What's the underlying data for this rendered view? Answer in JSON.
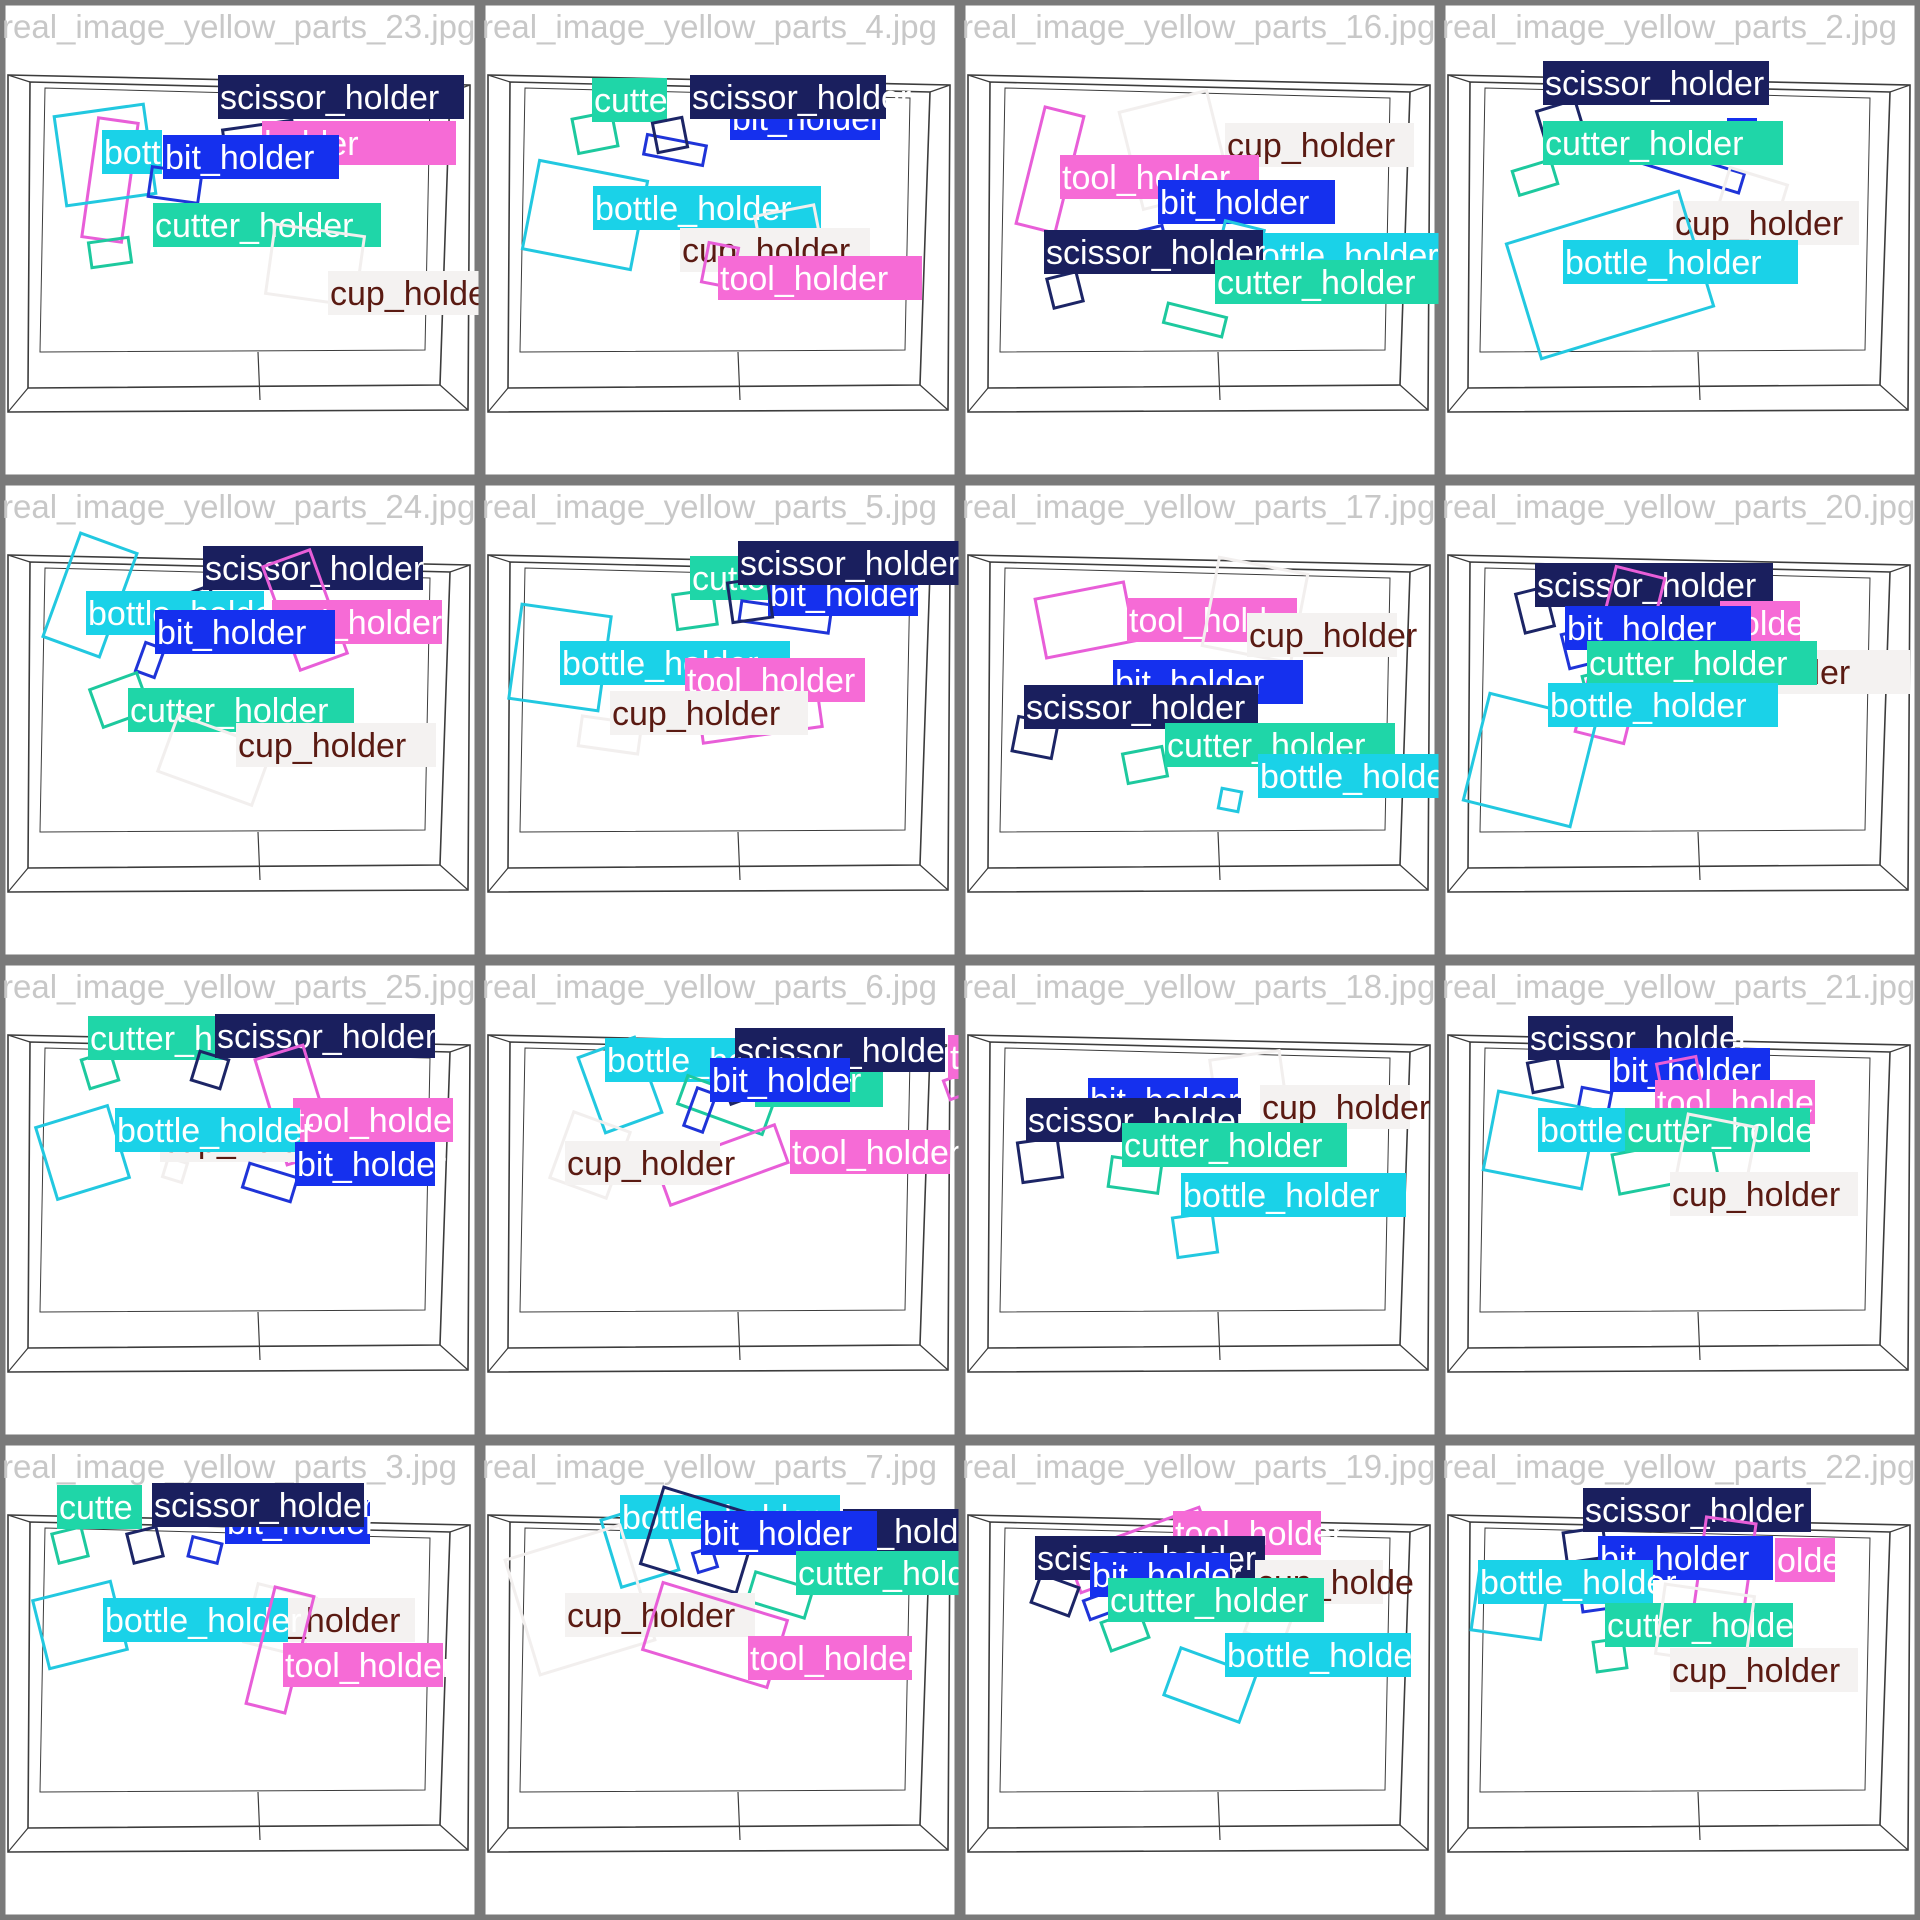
{
  "classes": {
    "scissor_holder": {
      "box": "#1c2566",
      "label_bg": "#1a1f5e",
      "label_fg": "#ffffff"
    },
    "bit_holder": {
      "box": "#1f34d8",
      "label_bg": "#1530ee",
      "label_fg": "#ffffff"
    },
    "tool_holder": {
      "box": "#e85ed8",
      "label_bg": "#f66bd6",
      "label_fg": "#ffffff"
    },
    "cutter_holder": {
      "box": "#1dc99e",
      "label_bg": "#1fd6a8",
      "label_fg": "#ffffff"
    },
    "bottle_holder": {
      "box": "#22c8e0",
      "label_bg": "#1ad2e8",
      "label_fg": "#ffffff"
    },
    "cup_holder": {
      "box": "#f2efee",
      "label_bg": "#f4f2f1",
      "label_fg": "#5a1a12"
    }
  },
  "tiles": [
    {
      "title": "real_image_yellow_parts_23.jpg",
      "labels": [
        {
          "cls": "scissor_holder",
          "text": "scissor_holder"
        },
        {
          "cls": "tool_holder",
          "text": "holder"
        },
        {
          "cls": "bottle_holder",
          "text": "bott"
        },
        {
          "cls": "bit_holder",
          "text": "bit_holder"
        },
        {
          "cls": "cutter_holder",
          "text": "cutter_holder"
        },
        {
          "cls": "cup_holder",
          "text": "cup_holder"
        }
      ]
    },
    {
      "title": "real_image_yellow_parts_4.jpg",
      "labels": [
        {
          "cls": "cutter_holder",
          "text": "cutter"
        },
        {
          "cls": "bit_holder",
          "text": "bit_holder"
        },
        {
          "cls": "scissor_holder",
          "text": "scissor_holder"
        },
        {
          "cls": "bottle_holder",
          "text": "bottle_holder"
        },
        {
          "cls": "cup_holder",
          "text": "cup_holder"
        },
        {
          "cls": "tool_holder",
          "text": "tool_holder"
        }
      ]
    },
    {
      "title": "real_image_yellow_parts_16.jpg",
      "labels": [
        {
          "cls": "cup_holder",
          "text": "cup_holder"
        },
        {
          "cls": "tool_holder",
          "text": "tool_holder"
        },
        {
          "cls": "bit_holder",
          "text": "bit_holder"
        },
        {
          "cls": "bottle_holder",
          "text": "bottle_holder"
        },
        {
          "cls": "scissor_holder",
          "text": "scissor_holder"
        },
        {
          "cls": "cutter_holder",
          "text": "cutter_holder"
        }
      ]
    },
    {
      "title": "real_image_yellow_parts_2.jpg",
      "labels": [
        {
          "cls": "scissor_holder",
          "text": "scissor_holder"
        },
        {
          "cls": "bit_holder",
          "text": "r"
        },
        {
          "cls": "cutter_holder",
          "text": "cutter_holder"
        },
        {
          "cls": "cup_holder",
          "text": "cup_holder"
        },
        {
          "cls": "bottle_holder",
          "text": "bottle_holder"
        }
      ]
    },
    {
      "title": "real_image_yellow_parts_24.jpg",
      "labels": [
        {
          "cls": "scissor_holder",
          "text": "scissor_holder"
        },
        {
          "cls": "bottle_holder",
          "text": "bottle_holder"
        },
        {
          "cls": "tool_holder",
          "text": "tool_holder"
        },
        {
          "cls": "bit_holder",
          "text": "bit_holder"
        },
        {
          "cls": "cutter_holder",
          "text": "cutter_holder"
        },
        {
          "cls": "cup_holder",
          "text": "cup_holder"
        }
      ]
    },
    {
      "title": "real_image_yellow_parts_5.jpg",
      "labels": [
        {
          "cls": "cutter_holder",
          "text": "cutter"
        },
        {
          "cls": "bit_holder",
          "text": "bit_holder"
        },
        {
          "cls": "scissor_holder",
          "text": "scissor_holder"
        },
        {
          "cls": "bottle_holder",
          "text": "bottle_holder"
        },
        {
          "cls": "tool_holder",
          "text": "tool_holder"
        },
        {
          "cls": "cup_holder",
          "text": "cup_holder"
        }
      ]
    },
    {
      "title": "real_image_yellow_parts_17.jpg",
      "labels": [
        {
          "cls": "tool_holder",
          "text": "tool_hold"
        },
        {
          "cls": "cup_holder",
          "text": "cup_holder"
        },
        {
          "cls": "bit_holder",
          "text": "bit_holder"
        },
        {
          "cls": "scissor_holder",
          "text": "scissor_holder"
        },
        {
          "cls": "cutter_holder",
          "text": "cutter_holder"
        },
        {
          "cls": "bottle_holder",
          "text": "bottle_holder"
        }
      ]
    },
    {
      "title": "real_image_yellow_parts_20.jpg",
      "labels": [
        {
          "cls": "scissor_holder",
          "text": "scissor_holder"
        },
        {
          "cls": "tool_holder",
          "text": "holder"
        },
        {
          "cls": "bit_holder",
          "text": "bit_holder"
        },
        {
          "cls": "cup_holder",
          "text": "cup_holder"
        },
        {
          "cls": "cutter_holder",
          "text": "cutter_holder"
        },
        {
          "cls": "bottle_holder",
          "text": "bottle_holder"
        }
      ]
    },
    {
      "title": "real_image_yellow_parts_25.jpg",
      "labels": [
        {
          "cls": "cutter_holder",
          "text": "cutter_h"
        },
        {
          "cls": "scissor_holder",
          "text": "scissor_holder"
        },
        {
          "cls": "tool_holder",
          "text": "tool_holder"
        },
        {
          "cls": "cup_holder",
          "text": "cup_hold"
        },
        {
          "cls": "bottle_holder",
          "text": "bottle_holder"
        },
        {
          "cls": "bit_holder",
          "text": "bit_holder"
        }
      ]
    },
    {
      "title": "real_image_yellow_parts_6.jpg",
      "labels": [
        {
          "cls": "bottle_holder",
          "text": "bottle_ho"
        },
        {
          "cls": "cutter_holder",
          "text": "holder"
        },
        {
          "cls": "scissor_holder",
          "text": "scissor_holder"
        },
        {
          "cls": "bit_holder",
          "text": "bit_holder"
        },
        {
          "cls": "tool_holder",
          "text": "tool_holder"
        },
        {
          "cls": "cup_holder",
          "text": "cup_holder"
        },
        {
          "cls": "tool_holder",
          "text": "tool_holder"
        }
      ]
    },
    {
      "title": "real_image_yellow_parts_18.jpg",
      "labels": [
        {
          "cls": "cup_holder",
          "text": "cup_holder"
        },
        {
          "cls": "bit_holder",
          "text": "bit_holder"
        },
        {
          "cls": "scissor_holder",
          "text": "scissor_holder"
        },
        {
          "cls": "cutter_holder",
          "text": "cutter_holder"
        },
        {
          "cls": "bottle_holder",
          "text": "bottle_holder"
        }
      ]
    },
    {
      "title": "real_image_yellow_parts_21.jpg",
      "labels": [
        {
          "cls": "scissor_holder",
          "text": "scissor_holder"
        },
        {
          "cls": "bit_holder",
          "text": "bit_holder"
        },
        {
          "cls": "tool_holder",
          "text": "tool_holder"
        },
        {
          "cls": "bottle_holder",
          "text": "bottle"
        },
        {
          "cls": "cutter_holder",
          "text": "cutter_holder"
        },
        {
          "cls": "cup_holder",
          "text": "cup_holder"
        }
      ]
    },
    {
      "title": "real_image_yellow_parts_3.jpg",
      "labels": [
        {
          "cls": "cutter_holder",
          "text": "cutte"
        },
        {
          "cls": "bit_holder",
          "text": "bit_holder"
        },
        {
          "cls": "scissor_holder",
          "text": "scissor_holder"
        },
        {
          "cls": "cup_holder",
          "text": "_holder"
        },
        {
          "cls": "bottle_holder",
          "text": "bottle_holder"
        },
        {
          "cls": "tool_holder",
          "text": "tool_holder"
        }
      ]
    },
    {
      "title": "real_image_yellow_parts_7.jpg",
      "labels": [
        {
          "cls": "bottle_holder",
          "text": "bottle_holder"
        },
        {
          "cls": "scissor_holder",
          "text": "or_holder"
        },
        {
          "cls": "bit_holder",
          "text": "bit_holder"
        },
        {
          "cls": "cutter_holder",
          "text": "cutter_holder"
        },
        {
          "cls": "cup_holder",
          "text": "cup_holder"
        },
        {
          "cls": "tool_holder",
          "text": "tool_holder"
        }
      ]
    },
    {
      "title": "real_image_yellow_parts_19.jpg",
      "labels": [
        {
          "cls": "tool_holder",
          "text": "tool_holder"
        },
        {
          "cls": "scissor_holder",
          "text": "scissor_holder"
        },
        {
          "cls": "bit_holder",
          "text": "bit_holder"
        },
        {
          "cls": "cup_holder",
          "text": "cup_holde"
        },
        {
          "cls": "cutter_holder",
          "text": "cutter_holder"
        },
        {
          "cls": "bottle_holder",
          "text": "bottle_holder"
        }
      ]
    },
    {
      "title": "real_image_yellow_parts_22.jpg",
      "labels": [
        {
          "cls": "scissor_holder",
          "text": "scissor_holder"
        },
        {
          "cls": "tool_holder",
          "text": "older"
        },
        {
          "cls": "bit_holder",
          "text": "bit_holder"
        },
        {
          "cls": "bottle_holder",
          "text": "bottle_holder"
        },
        {
          "cls": "cutter_holder",
          "text": "cutter_holder"
        },
        {
          "cls": "cup_holder",
          "text": "cup_holder"
        }
      ]
    }
  ]
}
